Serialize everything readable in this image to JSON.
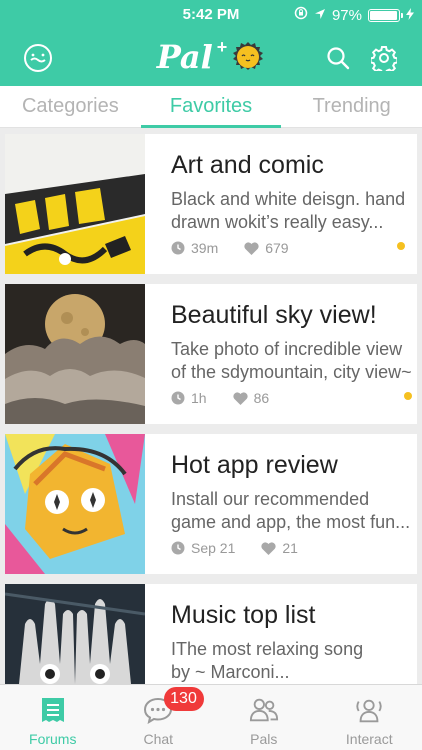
{
  "status": {
    "time": "5:42 PM",
    "battery_text": "97%",
    "battery_level": 0.97
  },
  "header": {
    "logo_text": "Pal",
    "logo_plus": "+"
  },
  "tabs": [
    {
      "label": "Categories",
      "active": false
    },
    {
      "label": "Favorites",
      "active": true
    },
    {
      "label": "Trending",
      "active": false
    }
  ],
  "posts": [
    {
      "title": "Art and comic",
      "desc_line1": "Black and white deisgn. hand",
      "desc_line2": "drawn wokit’s really easy...",
      "time": "39m",
      "likes": "679",
      "unread": true
    },
    {
      "title": "Beautiful sky view!",
      "desc_line1": "Take photo of incredible view",
      "desc_line2": "of the sdymountain, city view~",
      "time": "1h",
      "likes": "86",
      "unread": true
    },
    {
      "title": "Hot app review",
      "desc_line1": "Install our recommended",
      "desc_line2": "game and app, the most fun...",
      "time": "Sep 21",
      "likes": "21",
      "unread": false
    },
    {
      "title": "Music top list",
      "desc_line1": "IThe most relaxing song",
      "desc_line2": "by ~ Marconi...",
      "time": "",
      "likes": "",
      "unread": false
    }
  ],
  "tabbar": {
    "forums": "Forums",
    "chat": "Chat",
    "chat_badge": "130",
    "pals": "Pals",
    "interact": "Interact"
  },
  "colors": {
    "accent": "#3ecba6",
    "badge": "#f03a3a",
    "unread": "#f5c020"
  }
}
